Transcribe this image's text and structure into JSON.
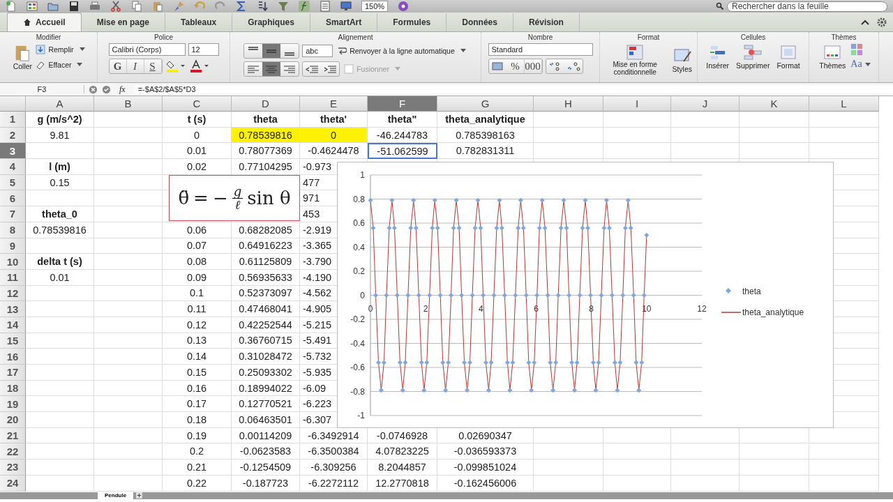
{
  "toolbar": {
    "zoom": "150%",
    "search": {
      "placeholder": "Rechercher dans la feuille"
    }
  },
  "tabs": [
    {
      "label": "Accueil",
      "selected": true
    },
    {
      "label": "Mise en page",
      "selected": false
    },
    {
      "label": "Tableaux",
      "selected": false
    },
    {
      "label": "Graphiques",
      "selected": false
    },
    {
      "label": "SmartArt",
      "selected": false
    },
    {
      "label": "Formules",
      "selected": false
    },
    {
      "label": "Données",
      "selected": false
    },
    {
      "label": "Révision",
      "selected": false
    }
  ],
  "ribbon": {
    "modifier": {
      "title": "Modifier",
      "paste": "Coller",
      "fill": "Remplir",
      "clear": "Effacer"
    },
    "police": {
      "title": "Police",
      "font": "Calibri (Corps)",
      "size": "12",
      "bold": "G",
      "italic": "I",
      "strike": "S"
    },
    "alignement": {
      "title": "Alignement",
      "vertical": [
        {
          "selected": false
        },
        {
          "selected": true
        },
        {
          "selected": false
        }
      ],
      "horizontal": [
        {
          "selected": false
        },
        {
          "selected": true
        },
        {
          "selected": false
        }
      ],
      "orientation": "abc",
      "wrap": "Renvoyer à la ligne automatique",
      "merge": {
        "label": "Fusionner",
        "disabled": true
      }
    },
    "nombre": {
      "title": "Nombre",
      "format": "Standard",
      "percent": "%",
      "thousands": "000"
    },
    "format": {
      "title": "Format",
      "conditional": "Mise en forme conditionnelle",
      "styles": "Styles"
    },
    "cellules": {
      "title": "Cellules",
      "insert": "Insérer",
      "delete": "Supprimer",
      "format": "Format"
    },
    "themes": {
      "title": "Thèmes",
      "themes": "Thèmes",
      "fonts": "Aa"
    }
  },
  "formula_bar": {
    "cell": "F3",
    "fx": "fx",
    "formula": "=-$A$2/$A$5*D3"
  },
  "columns": [
    {
      "label": "A",
      "selected": false
    },
    {
      "label": "B",
      "selected": false
    },
    {
      "label": "C",
      "selected": false
    },
    {
      "label": "D",
      "selected": false
    },
    {
      "label": "E",
      "selected": false
    },
    {
      "label": "F",
      "selected": true
    },
    {
      "label": "G",
      "selected": false
    },
    {
      "label": "H",
      "selected": false
    },
    {
      "label": "I",
      "selected": false
    },
    {
      "label": "J",
      "selected": false
    },
    {
      "label": "K",
      "selected": false
    },
    {
      "label": "L",
      "selected": false
    }
  ],
  "rows": [
    {
      "label": "1",
      "selected": false,
      "cells": {
        "A": {
          "text": "g (m/s^2)",
          "kind": "label"
        },
        "C": {
          "text": "t (s)",
          "kind": "label"
        },
        "D": {
          "text": "theta",
          "kind": "label"
        },
        "E": {
          "text": "theta'",
          "kind": "label"
        },
        "F": {
          "text": "theta\"",
          "kind": "label"
        },
        "G": {
          "text": "theta_analytique",
          "kind": "label"
        }
      }
    },
    {
      "label": "2",
      "selected": false,
      "cells": {
        "A": {
          "text": "9.81",
          "kind": "value"
        },
        "C": {
          "text": "0",
          "kind": "value"
        },
        "D": {
          "text": "0.78539816",
          "kind": "marked"
        },
        "E": {
          "text": "0",
          "kind": "marked"
        },
        "F": {
          "text": "-46.244783",
          "kind": "value"
        },
        "G": {
          "text": "0.785398163",
          "kind": "value"
        }
      }
    },
    {
      "label": "3",
      "selected": true,
      "cells": {
        "C": {
          "text": "0.01",
          "kind": "value"
        },
        "D": {
          "text": "0.78077369",
          "kind": "value"
        },
        "E": {
          "text": "-0.4624478",
          "kind": "value"
        },
        "F": {
          "text": "-51.062599",
          "kind": "active"
        },
        "G": {
          "text": "0.782831311",
          "kind": "value"
        }
      }
    },
    {
      "label": "4",
      "selected": false,
      "cells": {
        "A": {
          "text": "l (m)",
          "kind": "label"
        },
        "C": {
          "text": "0.02",
          "kind": "value"
        },
        "D": {
          "text": "0.77104295",
          "kind": "value"
        },
        "E": {
          "text": "-0.973",
          "kind": "clipped"
        }
      }
    },
    {
      "label": "5",
      "selected": false,
      "cells": {
        "A": {
          "text": "0.15",
          "kind": "value"
        },
        "E": {
          "text": "477",
          "kind": "clipped"
        }
      }
    },
    {
      "label": "6",
      "selected": false,
      "cells": {
        "E": {
          "text": "971",
          "kind": "clipped"
        }
      }
    },
    {
      "label": "7",
      "selected": false,
      "cells": {
        "A": {
          "text": "theta_0",
          "kind": "label"
        },
        "E": {
          "text": "453",
          "kind": "clipped"
        }
      }
    },
    {
      "label": "8",
      "selected": false,
      "cells": {
        "A": {
          "text": "0.78539816",
          "kind": "value"
        },
        "C": {
          "text": "0.06",
          "kind": "value"
        },
        "D": {
          "text": "0.68282085",
          "kind": "value"
        },
        "E": {
          "text": "-2.919",
          "kind": "clipped"
        }
      }
    },
    {
      "label": "9",
      "selected": false,
      "cells": {
        "C": {
          "text": "0.07",
          "kind": "value"
        },
        "D": {
          "text": "0.64916223",
          "kind": "value"
        },
        "E": {
          "text": "-3.365",
          "kind": "clipped"
        }
      }
    },
    {
      "label": "10",
      "selected": false,
      "cells": {
        "A": {
          "text": "delta t (s)",
          "kind": "label"
        },
        "C": {
          "text": "0.08",
          "kind": "value"
        },
        "D": {
          "text": "0.61125809",
          "kind": "value"
        },
        "E": {
          "text": "-3.790",
          "kind": "clipped"
        }
      }
    },
    {
      "label": "11",
      "selected": false,
      "cells": {
        "A": {
          "text": "0.01",
          "kind": "value"
        },
        "C": {
          "text": "0.09",
          "kind": "value"
        },
        "D": {
          "text": "0.56935633",
          "kind": "value"
        },
        "E": {
          "text": "-4.190",
          "kind": "clipped"
        }
      }
    },
    {
      "label": "12",
      "selected": false,
      "cells": {
        "C": {
          "text": "0.1",
          "kind": "value"
        },
        "D": {
          "text": "0.52373097",
          "kind": "value"
        },
        "E": {
          "text": "-4.562",
          "kind": "clipped"
        }
      }
    },
    {
      "label": "13",
      "selected": false,
      "cells": {
        "C": {
          "text": "0.11",
          "kind": "value"
        },
        "D": {
          "text": "0.47468041",
          "kind": "value"
        },
        "E": {
          "text": "-4.905",
          "kind": "clipped"
        }
      }
    },
    {
      "label": "14",
      "selected": false,
      "cells": {
        "C": {
          "text": "0.12",
          "kind": "value"
        },
        "D": {
          "text": "0.42252544",
          "kind": "value"
        },
        "E": {
          "text": "-5.215",
          "kind": "clipped"
        }
      }
    },
    {
      "label": "15",
      "selected": false,
      "cells": {
        "C": {
          "text": "0.13",
          "kind": "value"
        },
        "D": {
          "text": "0.36760715",
          "kind": "value"
        },
        "E": {
          "text": "-5.491",
          "kind": "clipped"
        }
      }
    },
    {
      "label": "16",
      "selected": false,
      "cells": {
        "C": {
          "text": "0.14",
          "kind": "value"
        },
        "D": {
          "text": "0.31028472",
          "kind": "value"
        },
        "E": {
          "text": "-5.732",
          "kind": "clipped"
        }
      }
    },
    {
      "label": "17",
      "selected": false,
      "cells": {
        "C": {
          "text": "0.15",
          "kind": "value"
        },
        "D": {
          "text": "0.25093302",
          "kind": "value"
        },
        "E": {
          "text": "-5.935",
          "kind": "clipped"
        }
      }
    },
    {
      "label": "18",
      "selected": false,
      "cells": {
        "C": {
          "text": "0.16",
          "kind": "value"
        },
        "D": {
          "text": "0.18994022",
          "kind": "value"
        },
        "E": {
          "text": "-6.09",
          "kind": "clipped"
        }
      }
    },
    {
      "label": "19",
      "selected": false,
      "cells": {
        "C": {
          "text": "0.17",
          "kind": "value"
        },
        "D": {
          "text": "0.12770521",
          "kind": "value"
        },
        "E": {
          "text": "-6.223",
          "kind": "clipped"
        }
      }
    },
    {
      "label": "20",
      "selected": false,
      "cells": {
        "C": {
          "text": "0.18",
          "kind": "value"
        },
        "D": {
          "text": "0.06463501",
          "kind": "value"
        },
        "E": {
          "text": "-6.307",
          "kind": "clipped"
        }
      }
    },
    {
      "label": "21",
      "selected": false,
      "cells": {
        "C": {
          "text": "0.19",
          "kind": "value"
        },
        "D": {
          "text": "0.00114209",
          "kind": "value"
        },
        "E": {
          "text": "-6.3492914",
          "kind": "value"
        },
        "F": {
          "text": "-0.0746928",
          "kind": "value"
        },
        "G": {
          "text": "0.02690347",
          "kind": "value"
        }
      }
    },
    {
      "label": "22",
      "selected": false,
      "cells": {
        "C": {
          "text": "0.2",
          "kind": "value"
        },
        "D": {
          "text": "-0.0623583",
          "kind": "value"
        },
        "E": {
          "text": "-6.3500384",
          "kind": "value"
        },
        "F": {
          "text": "4.07823225",
          "kind": "value"
        },
        "G": {
          "text": "-0.036593373",
          "kind": "value"
        }
      }
    },
    {
      "label": "23",
      "selected": false,
      "cells": {
        "C": {
          "text": "0.21",
          "kind": "value"
        },
        "D": {
          "text": "-0.1254509",
          "kind": "value"
        },
        "E": {
          "text": "-6.309256",
          "kind": "value"
        },
        "F": {
          "text": "8.2044857",
          "kind": "value"
        },
        "G": {
          "text": "-0.099851024",
          "kind": "value"
        }
      }
    },
    {
      "label": "24",
      "selected": false,
      "cells": {
        "C": {
          "text": "0.22",
          "kind": "value"
        },
        "D": {
          "text": "-0.187723",
          "kind": "value"
        },
        "E": {
          "text": "-6.2272112",
          "kind": "value"
        },
        "F": {
          "text": "12.2770818",
          "kind": "value"
        },
        "G": {
          "text": "-0.162456006",
          "kind": "value"
        }
      }
    }
  ],
  "equation": {
    "lhs": "θ̈",
    "relation": "=",
    "sign": "−",
    "numerator": "g",
    "denominator": "ℓ",
    "function": "sin θ"
  },
  "chart": {
    "chart_data": {
      "type": "scatter",
      "grid": true,
      "legend": true,
      "xlim": [
        0,
        12
      ],
      "ylim": [
        -1,
        1
      ],
      "xticks": [
        {
          "value": 0,
          "label": "0"
        },
        {
          "value": 2,
          "label": "2"
        },
        {
          "value": 4,
          "label": "4"
        },
        {
          "value": 6,
          "label": "6"
        },
        {
          "value": 8,
          "label": "8"
        },
        {
          "value": 10,
          "label": "10"
        },
        {
          "value": 12,
          "label": "12"
        }
      ],
      "yticks": [
        {
          "value": -1,
          "label": "-1"
        },
        {
          "value": -0.8,
          "label": "-0.8"
        },
        {
          "value": -0.6,
          "label": "-0.6"
        },
        {
          "value": -0.4,
          "label": "-0.4"
        },
        {
          "value": -0.2,
          "label": "-0.2"
        },
        {
          "value": 0,
          "label": "0"
        },
        {
          "value": 0.2,
          "label": "0.2"
        },
        {
          "value": 0.4,
          "label": "0.4"
        },
        {
          "value": 0.6,
          "label": "0.6"
        },
        {
          "value": 0.8,
          "label": "0.8"
        },
        {
          "value": 1,
          "label": "1"
        }
      ],
      "x": [
        0,
        0.1,
        0.19,
        0.29,
        0.39,
        0.49,
        0.58,
        0.68,
        0.78,
        0.87,
        0.97,
        1.07,
        1.17,
        1.26,
        1.36,
        1.46,
        1.56,
        1.65,
        1.75,
        1.85,
        1.94,
        2.04,
        2.14,
        2.24,
        2.33,
        2.43,
        2.53,
        2.62,
        2.72,
        2.82,
        2.92,
        3.01,
        3.11,
        3.21,
        3.3,
        3.4,
        3.5,
        3.6,
        3.69,
        3.79,
        3.89,
        3.99,
        4.08,
        4.18,
        4.28,
        4.37,
        4.47,
        4.57,
        4.67,
        4.76,
        4.86,
        4.96,
        5.05,
        5.15,
        5.25,
        5.35,
        5.44,
        5.54,
        5.64,
        5.73,
        5.83,
        5.93,
        6.03,
        6.12,
        6.22,
        6.32,
        6.42,
        6.51,
        6.61,
        6.71,
        6.8,
        6.9,
        7,
        7.1,
        7.19,
        7.29,
        7.39,
        7.48,
        7.58,
        7.68,
        7.78,
        7.87,
        7.97,
        8.07,
        8.16,
        8.26,
        8.36,
        8.46,
        8.55,
        8.65,
        8.75,
        8.85,
        8.94,
        9.04,
        9.14,
        9.23,
        9.33,
        9.43,
        9.53,
        9.62,
        9.72,
        9.82,
        9.91,
        10
      ],
      "series": [
        {
          "name": "theta",
          "color": "#7fa7dd",
          "values": [
            0.79,
            0.56,
            0,
            -0.56,
            -0.79,
            -0.56,
            0,
            0.56,
            0.79,
            0.56,
            0,
            -0.56,
            -0.79,
            -0.56,
            0,
            0.56,
            0.79,
            0.56,
            0,
            -0.56,
            -0.79,
            -0.56,
            0,
            0.56,
            0.79,
            0.56,
            0,
            -0.56,
            -0.79,
            -0.56,
            0,
            0.56,
            0.79,
            0.56,
            0,
            -0.56,
            -0.79,
            -0.56,
            0,
            0.56,
            0.79,
            0.56,
            0,
            -0.56,
            -0.79,
            -0.56,
            0,
            0.56,
            0.79,
            0.56,
            0,
            -0.56,
            -0.79,
            -0.56,
            0,
            0.56,
            0.79,
            0.56,
            0,
            -0.56,
            -0.79,
            -0.56,
            0,
            0.56,
            0.79,
            0.56,
            0,
            -0.56,
            -0.79,
            -0.56,
            0,
            0.56,
            0.79,
            0.56,
            0,
            -0.56,
            -0.79,
            -0.56,
            0,
            0.56,
            0.79,
            0.56,
            0,
            -0.56,
            -0.79,
            -0.56,
            0,
            0.56,
            0.79,
            0.56,
            0,
            -0.56,
            -0.79,
            -0.56,
            0,
            0.56,
            0.79,
            0.56,
            0,
            -0.56,
            -0.79,
            -0.56,
            0,
            0.5
          ]
        },
        {
          "name": "theta_analytique",
          "type": "line",
          "color": "#b03a3a",
          "values": [
            0.79,
            0.56,
            0,
            -0.56,
            -0.79,
            -0.56,
            0,
            0.56,
            0.79,
            0.56,
            0,
            -0.56,
            -0.79,
            -0.56,
            0,
            0.56,
            0.79,
            0.56,
            0,
            -0.56,
            -0.79,
            -0.56,
            0,
            0.56,
            0.79,
            0.56,
            0,
            -0.56,
            -0.79,
            -0.56,
            0,
            0.56,
            0.79,
            0.56,
            0,
            -0.56,
            -0.79,
            -0.56,
            0,
            0.56,
            0.79,
            0.56,
            0,
            -0.56,
            -0.79,
            -0.56,
            0,
            0.56,
            0.79,
            0.56,
            0,
            -0.56,
            -0.79,
            -0.56,
            0,
            0.56,
            0.79,
            0.56,
            0,
            -0.56,
            -0.79,
            -0.56,
            0,
            0.56,
            0.79,
            0.56,
            0,
            -0.56,
            -0.79,
            -0.56,
            0,
            0.56,
            0.79,
            0.56,
            0,
            -0.56,
            -0.79,
            -0.56,
            0,
            0.56,
            0.79,
            0.56,
            0,
            -0.56,
            -0.79,
            -0.56,
            0,
            0.56,
            0.79,
            0.56,
            0,
            -0.56,
            -0.79,
            -0.56,
            0,
            0.56,
            0.79,
            0.56,
            0,
            -0.56,
            -0.79,
            -0.56,
            0,
            0.5
          ]
        }
      ]
    }
  },
  "sheet_tabs": [
    {
      "label": "Pendule",
      "selected": true
    }
  ]
}
